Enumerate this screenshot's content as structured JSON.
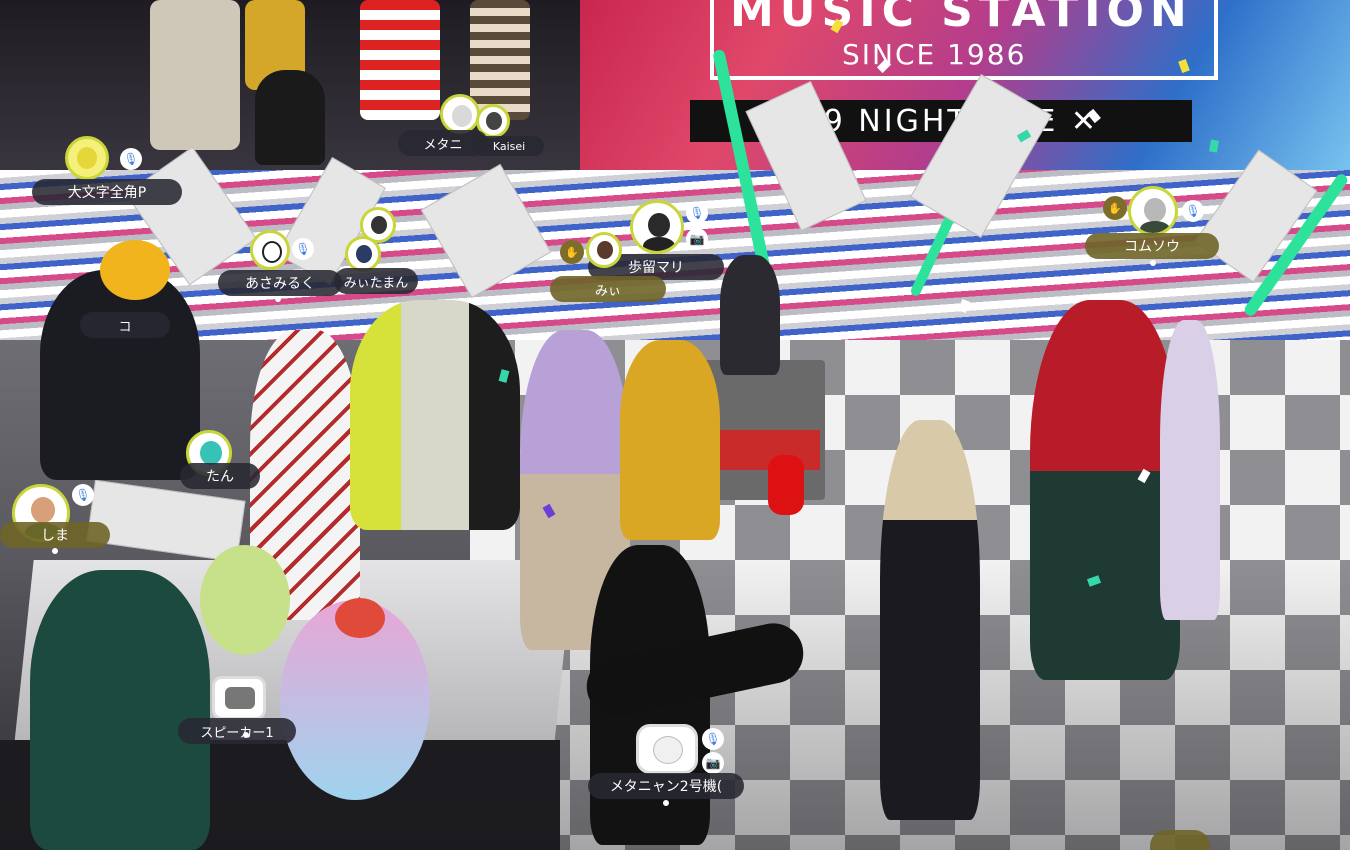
{
  "stage_screen": {
    "title": "MUSIC STATION",
    "since": "SINCE 1986",
    "banner": "✕ 9 NIGHT LIVE ✕"
  },
  "players": [
    {
      "id": "p1",
      "name": "大文字全角P",
      "mic": "muted"
    },
    {
      "id": "p2",
      "name": "あさみるく",
      "mic": "muted"
    },
    {
      "id": "p3",
      "name": "みぃたまん",
      "mic": "muted"
    },
    {
      "id": "p4",
      "name": "歩留マリ",
      "mic": "muted",
      "camera": true
    },
    {
      "id": "p5",
      "name": "みぃ",
      "mic": "muted"
    },
    {
      "id": "p6",
      "name": "コムソウ",
      "mic": "muted"
    },
    {
      "id": "p7",
      "name": "しま",
      "mic": "muted"
    },
    {
      "id": "p8",
      "name": "たん",
      "mic": "muted"
    },
    {
      "id": "p9",
      "name": "スピーカー1",
      "mic": "muted"
    },
    {
      "id": "p10",
      "name": "メタニャン2号機(",
      "mic": "muted",
      "camera": true
    },
    {
      "id": "p11",
      "name": "Kaisei",
      "mic": "muted"
    },
    {
      "id": "p12",
      "name": "メタニ",
      "mic": "muted"
    },
    {
      "id": "p13",
      "name": "コ",
      "mic": "muted"
    }
  ],
  "icons": {
    "mic_muted": "mic-muted-icon",
    "camera": "camera-icon",
    "clap": "clap-hands-icon"
  },
  "colors": {
    "beam": "#2de39b",
    "plate_dark": "#282832",
    "plate_olive": "#6e6428",
    "badge_ring": "#c9d63a",
    "icon_blue": "#3f7fe0"
  }
}
